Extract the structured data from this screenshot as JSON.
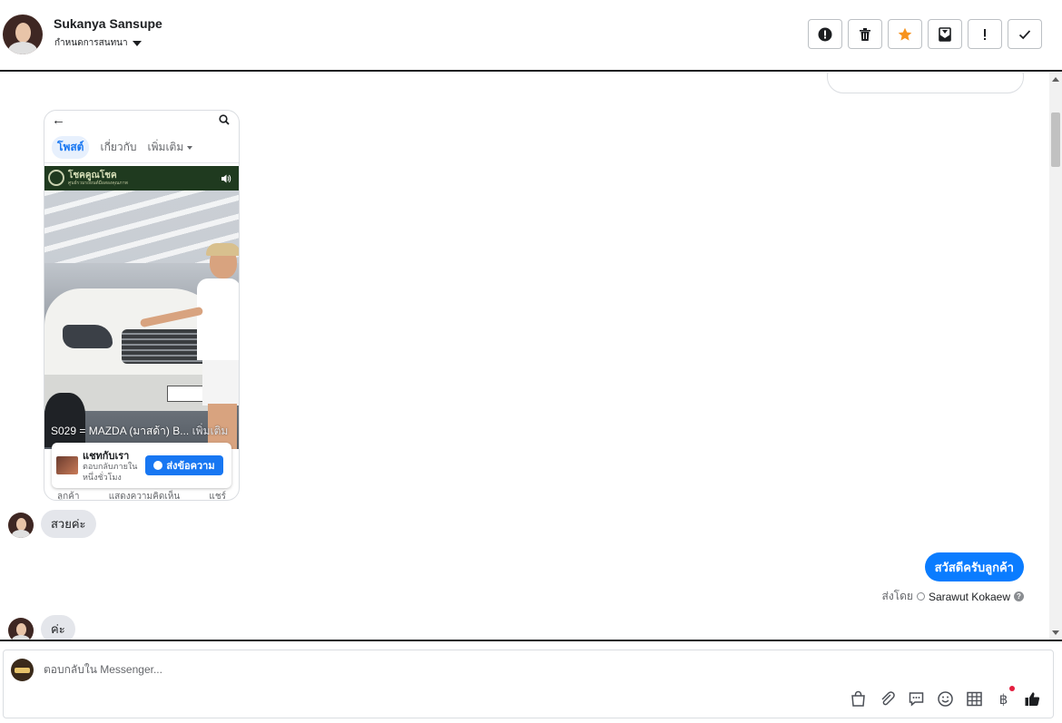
{
  "header": {
    "contact_name": "Sukanya Sansupe",
    "assign_label": "กำหนดการสนทนา",
    "toolbar": [
      {
        "name": "spam-button",
        "icon": "alert-circle-icon"
      },
      {
        "name": "delete-button",
        "icon": "trash-icon"
      },
      {
        "name": "star-button",
        "icon": "star-icon",
        "color": "#f7931e"
      },
      {
        "name": "mark-unread-button",
        "icon": "envelope-icon"
      },
      {
        "name": "follow-up-button",
        "icon": "exclamation-icon"
      },
      {
        "name": "mark-done-button",
        "icon": "check-icon"
      }
    ]
  },
  "conversation": {
    "shared_post": {
      "tabs": [
        "โพสต์",
        "เกี่ยวกับ",
        "เพิ่มเติม"
      ],
      "brand": "โชคคูณโชค",
      "brand_sub": "ศูนย์รวมรถยนต์มือสองคุณภาพ",
      "caption": "S029 =  MAZDA (มาสด้า)  B...",
      "caption_more": "เพิ่มเติม",
      "chat_title": "แชทกับเรา",
      "chat_sub": "ตอบกลับภายในหนึ่งชั่วโมง",
      "chat_button": "ส่งข้อความ",
      "bottom_tabs": [
        "ลูกค้า",
        "แสดงความคิดเห็น",
        "แชร์"
      ]
    },
    "messages": [
      {
        "direction": "in",
        "text": "สวยค่ะ"
      },
      {
        "direction": "out",
        "text": "สวัสดีครับลูกค้า"
      },
      {
        "direction": "in",
        "text": "ค่ะ"
      }
    ],
    "sent_by_label": "ส่งโดย",
    "sent_by_agent": "Sarawut Kokaew"
  },
  "composer": {
    "placeholder": "ตอบกลับใน Messenger...",
    "icons": [
      "shopping-bag-icon",
      "paperclip-icon",
      "saved-reply-icon",
      "emoji-icon",
      "table-icon",
      "baht-icon",
      "thumbs-up-icon"
    ],
    "baht_symbol": "฿"
  },
  "colors": {
    "accent": "#0a7cff",
    "star": "#f7931e",
    "bubble_in": "#e4e6eb"
  }
}
